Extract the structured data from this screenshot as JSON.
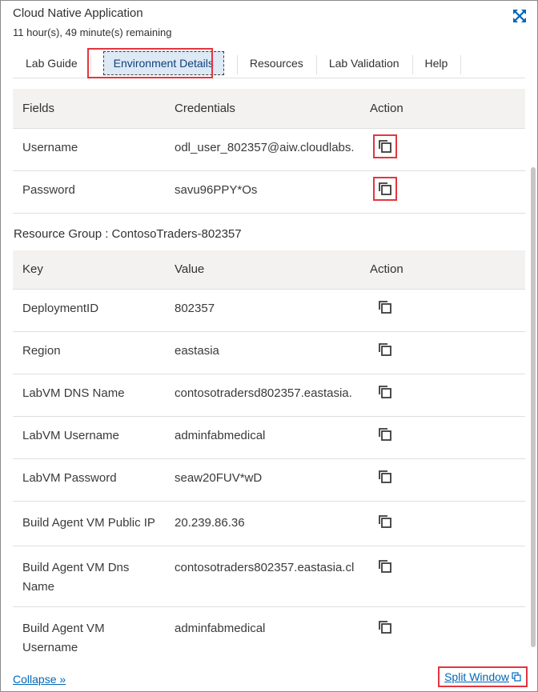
{
  "header": {
    "title": "Cloud Native Application",
    "time_remaining": "11 hour(s), 49 minute(s) remaining",
    "expand_icon": "expand-arrows-icon"
  },
  "tabs": [
    {
      "label": "Lab Guide",
      "active": false
    },
    {
      "label": "Environment Details",
      "active": true
    },
    {
      "label": "Resources",
      "active": false
    },
    {
      "label": "Lab Validation",
      "active": false
    },
    {
      "label": "Help",
      "active": false
    }
  ],
  "credentials_table": {
    "headers": [
      "Fields",
      "Credentials",
      "Action"
    ],
    "rows": [
      {
        "field": "Username",
        "value": "odl_user_802357@aiw.cloudlabs.",
        "highlight": true
      },
      {
        "field": "Password",
        "value": "savu96PPY*Os",
        "highlight": true
      }
    ]
  },
  "resource_group": {
    "title": "Resource Group : ContosoTraders-802357"
  },
  "resource_table": {
    "headers": [
      "Key",
      "Value",
      "Action"
    ],
    "rows": [
      {
        "key": "DeploymentID",
        "value": "802357"
      },
      {
        "key": "Region",
        "value": "eastasia"
      },
      {
        "key": "LabVM DNS Name",
        "value": "contosotradersd802357.eastasia."
      },
      {
        "key": "LabVM Username",
        "value": "adminfabmedical"
      },
      {
        "key": "LabVM Password",
        "value": "seaw20FUV*wD"
      },
      {
        "key": "Build Agent VM Public IP",
        "value": "20.239.86.36"
      },
      {
        "key": "Build Agent VM Dns Name",
        "value": "contosotraders802357.eastasia.cl"
      },
      {
        "key": "Build Agent VM Username",
        "value": "adminfabmedical"
      }
    ]
  },
  "footer": {
    "collapse_label": "Collapse »",
    "split_window_label": "Split Window",
    "split_icon": "split-window-icon"
  },
  "colors": {
    "highlight_red": "#e3353f",
    "link_blue": "#0067b8",
    "active_tab_bg": "#dde9f5",
    "header_row_bg": "#f3f2f1"
  }
}
